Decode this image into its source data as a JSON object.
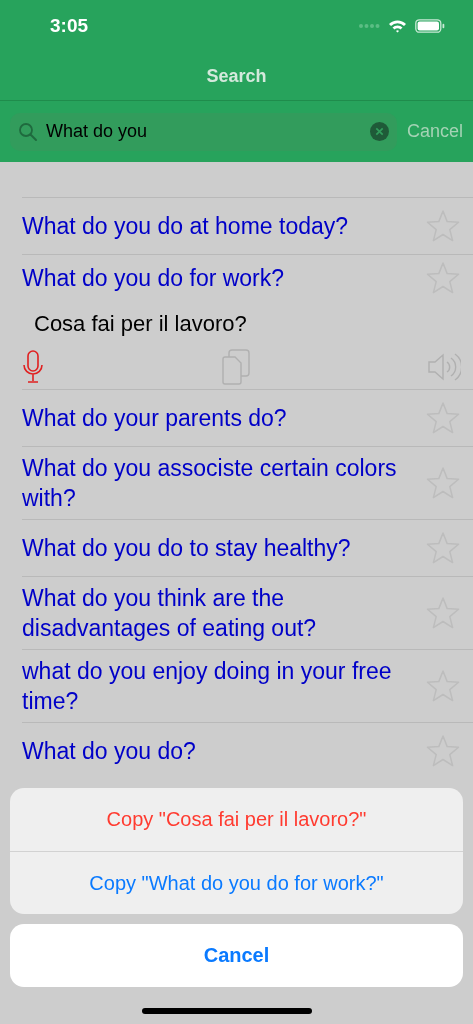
{
  "status_bar": {
    "time": "3:05"
  },
  "nav": {
    "title": "Search"
  },
  "search": {
    "value": "What do you",
    "cancel": "Cancel"
  },
  "rows": [
    {
      "text": "What do you do at home today?",
      "starred": false,
      "expanded": false
    },
    {
      "text": "What do you do for work?",
      "starred": false,
      "expanded": true,
      "translation": "Cosa fai per il lavoro?"
    },
    {
      "text": "What do your parents do?",
      "starred": false,
      "expanded": false
    },
    {
      "text": "What do you associste certain colors with?",
      "starred": false,
      "expanded": false
    },
    {
      "text": "What do you do to stay healthy?",
      "starred": false,
      "expanded": false
    },
    {
      "text": "What do you think are the disadvantages of eating out?",
      "starred": false,
      "expanded": false
    },
    {
      "text": "what do you enjoy doing in your free time?",
      "starred": false,
      "expanded": false
    },
    {
      "text": "What do you do?",
      "starred": false,
      "expanded": false
    }
  ],
  "action_sheet": {
    "actions": [
      {
        "label": "Copy \"Cosa fai per il lavoro?\"",
        "kind": "destructive"
      },
      {
        "label": "Copy \"What do you do for work?\"",
        "kind": "default"
      }
    ],
    "cancel": "Cancel"
  }
}
